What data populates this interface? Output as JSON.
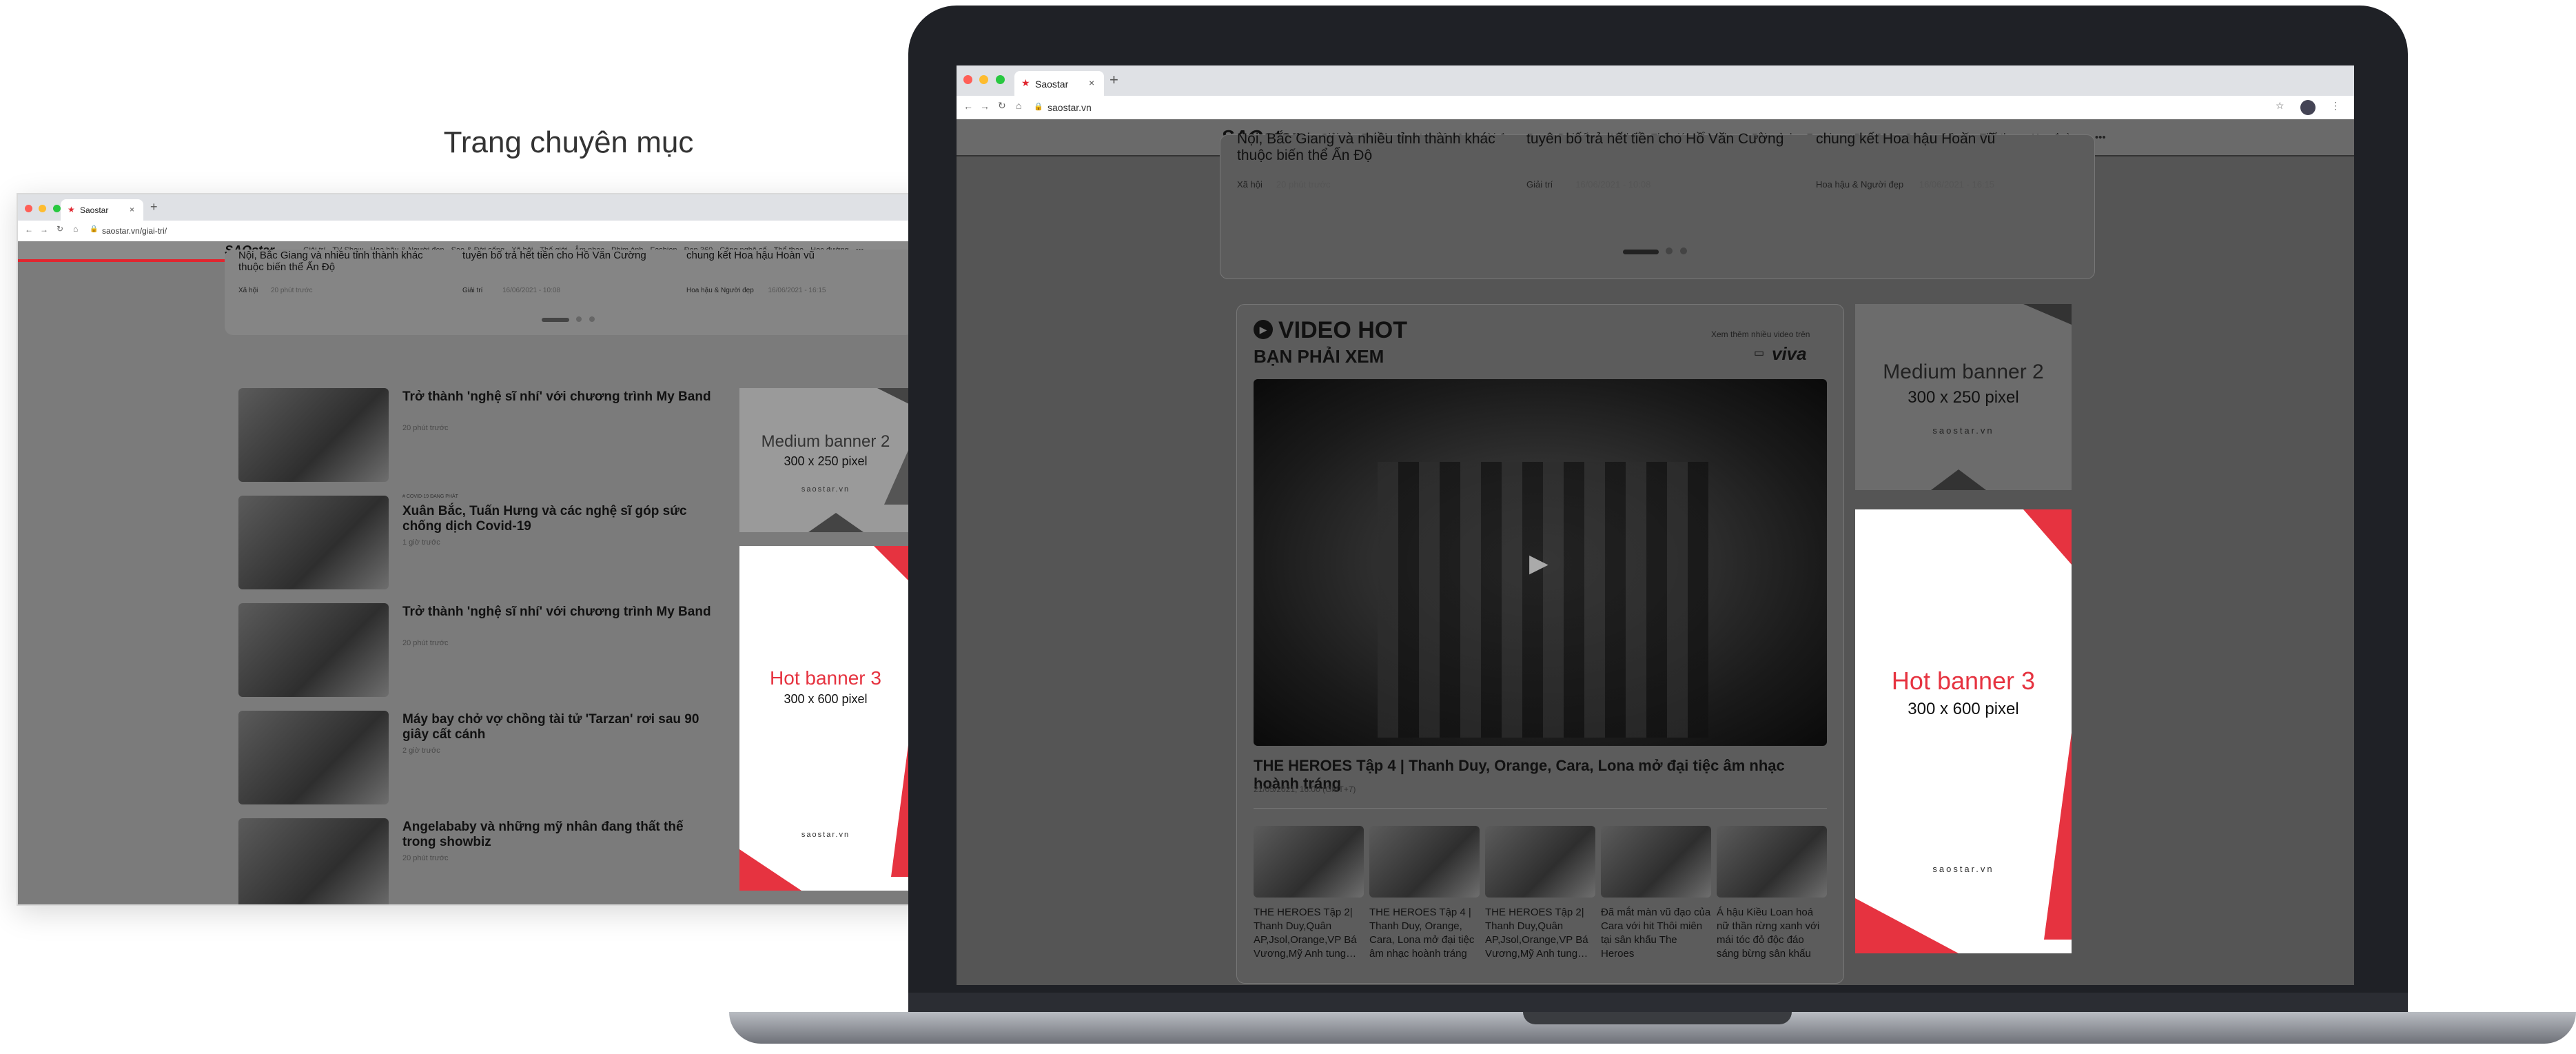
{
  "caption": "Trang chuyên mục",
  "left_window": {
    "tab_title": "Saostar",
    "url": "saostar.vn/giai-tri/",
    "logo": "SAOstar",
    "nav": [
      "Giải trí",
      "TV Show",
      "Hoa hậu & Người đẹp",
      "Sao & Đời sống",
      "Xã hội",
      "Thế giới",
      "Âm nhạc",
      "Phim ảnh",
      "Fashion",
      "Đẹp 360",
      "Công nghệ số",
      "Thể thao",
      "Học đường",
      "•••"
    ],
    "top_cards": [
      {
        "title": "Nội, Bắc Giang và nhiều tỉnh thành khác thuộc biến thể Ấn Độ",
        "cat": "Xã hội",
        "time": "20 phút trước"
      },
      {
        "title": "tuyên bố trả hết tiền cho Hồ Văn Cường",
        "cat": "Giải trí",
        "time": "16/06/2021 - 10:08"
      },
      {
        "title": "chung kết Hoa hậu Hoàn vũ",
        "cat": "Hoa hậu & Người đẹp",
        "time": "16/06/2021 - 16:15"
      }
    ],
    "articles": [
      {
        "title": "Trở thành 'nghệ sĩ nhí' với chương trình My Band",
        "meta": "20 phút trước",
        "tag": ""
      },
      {
        "title": "Xuân Bắc, Tuấn Hưng và các nghệ sĩ góp sức chống dịch Covid-19",
        "meta": "1 giờ trước",
        "tag": "# COVID-19 ĐANG PHÁT"
      },
      {
        "title": "Trở thành 'nghệ sĩ nhí' với chương trình My Band",
        "meta": "20 phút trước",
        "tag": ""
      },
      {
        "title": "Máy bay chở vợ chồng tài tử 'Tarzan' rơi sau 90 giây cất cánh",
        "meta": "2 giờ trước",
        "tag": ""
      },
      {
        "title": "Angelababy và những mỹ nhân đang thất thế trong showbiz",
        "meta": "20 phút trước",
        "tag": ""
      }
    ],
    "banner_medium": {
      "line1": "Medium banner 2",
      "line2": "300 x 250 pixel",
      "site": "saostar.vn"
    },
    "banner_hot": {
      "line1": "Hot banner 3",
      "line2": "300 x 600 pixel",
      "site": "saostar.vn"
    }
  },
  "laptop_window": {
    "tab_title": "Saostar",
    "url": "saostar.vn",
    "logo": "SAOstar",
    "nav": [
      "Giải trí",
      "TV Show",
      "Hoa hậu & Người đẹp",
      "Sao & Đời sống",
      "Xã hội",
      "Thế giới",
      "Âm nhạc",
      "Phim ảnh",
      "Fashion",
      "Đẹp 360",
      "Công nghệ số",
      "Thể thao",
      "Học đường",
      "•••"
    ],
    "top_cards": [
      {
        "title": "Nội, Bắc Giang và nhiều tỉnh thành khác thuộc biến thể Ấn Độ",
        "cat": "Xã hội",
        "time": "20 phút trước"
      },
      {
        "title": "tuyên bố trả hết tiền cho Hồ Văn Cường",
        "cat": "Giải trí",
        "time": "16/06/2021 - 10:08"
      },
      {
        "title": "chung kết Hoa hậu Hoàn vũ",
        "cat": "Hoa hậu & Người đẹp",
        "time": "16/06/2021 - 16:15"
      }
    ],
    "video": {
      "heading": "VIDEO HOT",
      "subheading": "BẠN PHẢI XEM",
      "more": "Xem thêm nhiều video trên",
      "brand": "viva",
      "main_title": "THE HEROES Tập 4 | Thanh Duy, Orange, Cara, Lona mở đại tiệc âm nhạc hoành tráng",
      "main_time": "21/05/2021, 16:00 (GMT+7)",
      "thumbs": [
        "THE HEROES Tập 2| Thanh Duy,Quân AP,Jsol,Orange,VP Bá Vương,Mỹ Anh tung…",
        "THE HEROES Tập 4 | Thanh Duy, Orange, Cara, Lona mở đại tiệc âm nhạc hoành tráng",
        "THE HEROES Tập 2| Thanh Duy,Quân AP,Jsol,Orange,VP Bá Vương,Mỹ Anh tung…",
        "Đã mắt màn vũ đạo của Cara với hit Thôi miên tại sân khấu The Heroes",
        "Á hậu Kiều Loan hoá nữ thần rừng xanh với mái tóc đỏ độc đáo sáng bừng sân khấu"
      ]
    },
    "banner_medium": {
      "line1": "Medium banner 2",
      "line2": "300 x 250 pixel",
      "site": "saostar.vn"
    },
    "banner_hot": {
      "line1": "Hot banner 3",
      "line2": "300 x 600 pixel",
      "site": "saostar.vn"
    }
  }
}
